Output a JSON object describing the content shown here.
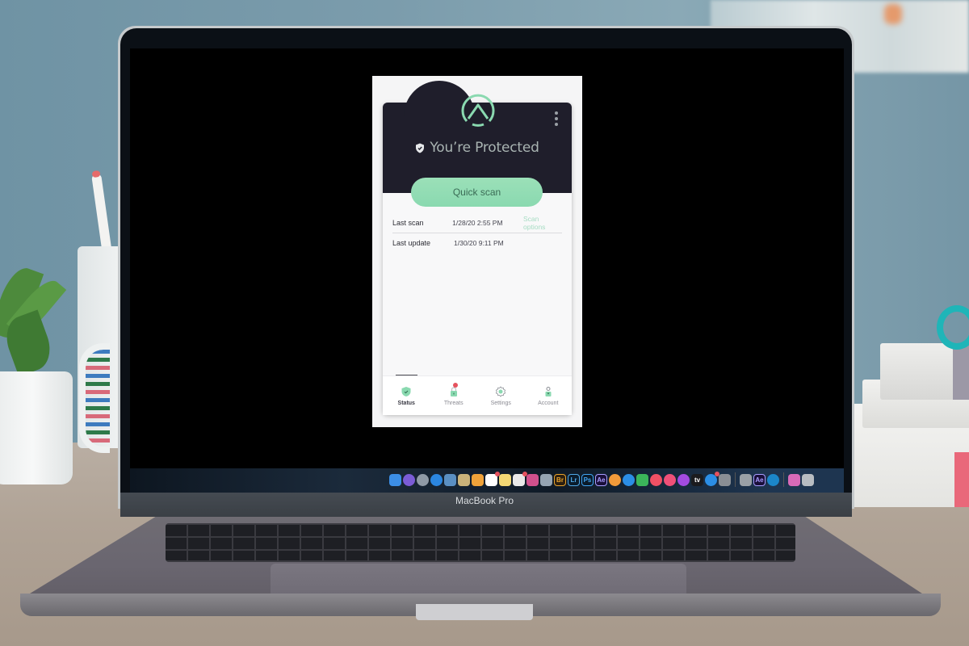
{
  "app": {
    "status_title": "You’re Protected",
    "quick_scan_label": "Quick scan",
    "info": [
      {
        "label": "Last scan",
        "value": "1/28/20 2:55 PM",
        "link": "Scan options"
      },
      {
        "label": "Last update",
        "value": "1/30/20 9:11 PM"
      }
    ],
    "tabs": [
      {
        "label": "Status",
        "icon": "shield-check-icon",
        "active": true
      },
      {
        "label": "Threats",
        "icon": "lock-alert-icon",
        "badge": true
      },
      {
        "label": "Settings",
        "icon": "gear-icon"
      },
      {
        "label": "Account",
        "icon": "user-icon"
      }
    ],
    "colors": {
      "header": "#1f1e2b",
      "accent": "#8ad9b0",
      "accent_text": "#3a6b55",
      "badge": "#e5525e"
    }
  },
  "device": {
    "brand_label": "MacBook Pro"
  },
  "dock": {
    "items": [
      {
        "name": "finder",
        "color": "#3c8ee6"
      },
      {
        "name": "siri",
        "color": "#7b5cd6"
      },
      {
        "name": "launchpad",
        "color": "#8f9aa6"
      },
      {
        "name": "safari",
        "color": "#2b86e0"
      },
      {
        "name": "preview",
        "color": "#5a8fc2"
      },
      {
        "name": "notes-stack",
        "color": "#c9b27a"
      },
      {
        "name": "pages",
        "color": "#f0a33a"
      },
      {
        "name": "calendar",
        "color": "#ffffff",
        "badge": true
      },
      {
        "name": "stickies",
        "color": "#f2d774"
      },
      {
        "name": "reminders",
        "color": "#e9e9e9",
        "badge": true
      },
      {
        "name": "final-cut",
        "color": "#d0508c"
      },
      {
        "name": "photo-booth",
        "color": "#95a4b2"
      },
      {
        "name": "bridge",
        "text": "Br",
        "color": "#2c1f0f",
        "fg": "#e8a32c"
      },
      {
        "name": "lightroom",
        "text": "Lr",
        "color": "#0a1b2b",
        "fg": "#4fa8e6"
      },
      {
        "name": "photoshop",
        "text": "Ps",
        "color": "#0a1b2b",
        "fg": "#41a5f3"
      },
      {
        "name": "after-effects",
        "text": "Ae",
        "color": "#1a0f3a",
        "fg": "#a89dff"
      },
      {
        "name": "photos",
        "color": "#f09a3a"
      },
      {
        "name": "messages-blue",
        "color": "#2b8ee6"
      },
      {
        "name": "facetime",
        "color": "#3bb55a"
      },
      {
        "name": "news",
        "color": "#f05064"
      },
      {
        "name": "music",
        "color": "#f05078"
      },
      {
        "name": "podcasts",
        "color": "#a24be0"
      },
      {
        "name": "apple-tv",
        "text": "tv",
        "color": "#1b1b1e"
      },
      {
        "name": "app-store",
        "color": "#2b8ee6",
        "badge": true
      },
      {
        "name": "system-preferences",
        "color": "#8a8e94"
      },
      {
        "name": "sep"
      },
      {
        "name": "documents",
        "color": "#9aa0a6"
      },
      {
        "name": "after-effects-2",
        "text": "Ae",
        "color": "#1a0f3a",
        "fg": "#a89dff"
      },
      {
        "name": "edge",
        "color": "#1b86c9"
      },
      {
        "name": "sep"
      },
      {
        "name": "downloads",
        "color": "#d86ab8"
      },
      {
        "name": "trash",
        "color": "#b8bdc2"
      }
    ]
  }
}
